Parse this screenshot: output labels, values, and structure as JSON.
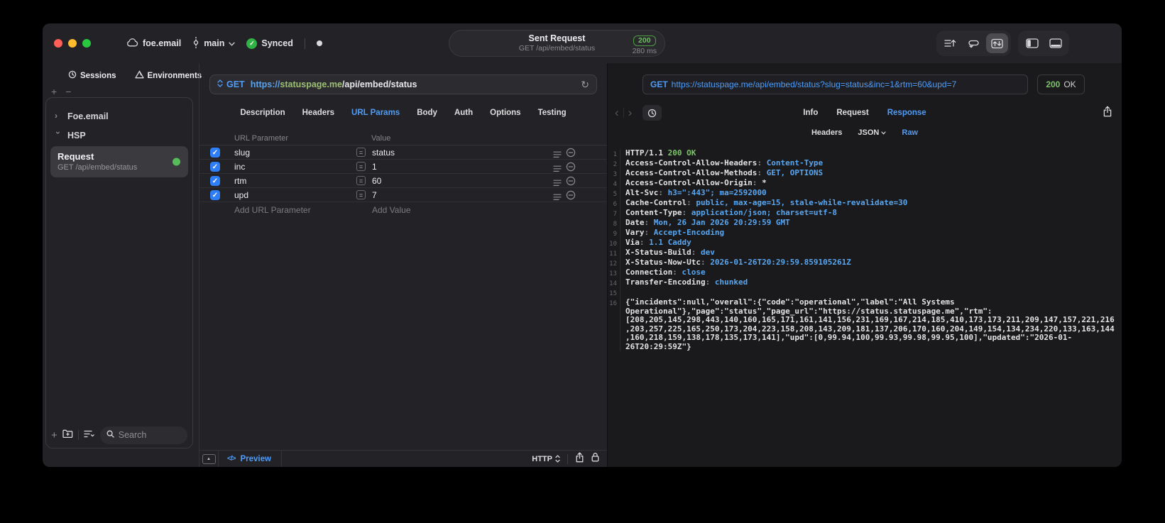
{
  "titlebar": {
    "project": "foe.email",
    "branch": "main",
    "sync_status": "Synced",
    "request_summary": {
      "title": "Sent Request",
      "method_path": "GET /api/embed/status",
      "status_code": "200",
      "duration": "280 ms"
    }
  },
  "sidebar": {
    "tabs": [
      {
        "label": "Sessions",
        "icon": "clock-icon"
      },
      {
        "label": "Environments",
        "icon": "prism-icon"
      }
    ],
    "active_tab": "Sessions",
    "tree": [
      {
        "label": "Foe.email",
        "expanded": false
      },
      {
        "label": "HSP",
        "expanded": true
      }
    ],
    "request_item": {
      "title": "Request",
      "subtitle": "GET /api/embed/status",
      "status_dot_color": "#56bd5b"
    },
    "search_placeholder": "Search"
  },
  "request_editor": {
    "method": "GET",
    "url": {
      "scheme": "https://",
      "host": "statuspage.me",
      "path": "/api/embed/status"
    },
    "tabs": [
      "Description",
      "Headers",
      "URL Params",
      "Body",
      "Auth",
      "Options",
      "Testing"
    ],
    "active_tab": "URL Params",
    "params": {
      "columns": [
        "URL Parameter",
        "Value"
      ],
      "rows": [
        {
          "enabled": true,
          "name": "slug",
          "value": "status"
        },
        {
          "enabled": true,
          "name": "inc",
          "value": "1"
        },
        {
          "enabled": true,
          "name": "rtm",
          "value": "60"
        },
        {
          "enabled": true,
          "name": "upd",
          "value": "7"
        }
      ],
      "add_name_placeholder": "Add URL Parameter",
      "add_value_placeholder": "Add Value"
    },
    "footer": {
      "code_icon": "</>",
      "preview_label": "Preview",
      "protocol": "HTTP"
    }
  },
  "response_viewer": {
    "request_line": {
      "method": "GET",
      "url": "https://statuspage.me/api/embed/status?slug=status&inc=1&rtm=60&upd=7"
    },
    "status": {
      "code": "200",
      "label": "OK"
    },
    "tabs": [
      "Info",
      "Request",
      "Response"
    ],
    "active_tab": "Response",
    "subtabs": [
      "Headers",
      "JSON",
      "Raw"
    ],
    "active_subtab": "Raw",
    "lines": [
      {
        "n": 1,
        "seg": [
          [
            "HTTP/1.1 ",
            "w"
          ],
          [
            "200 OK",
            "g"
          ]
        ]
      },
      {
        "n": 2,
        "seg": [
          [
            "Access-Control-Allow-Headers",
            "w"
          ],
          [
            ": ",
            "d"
          ],
          [
            "Content-Type",
            "b"
          ]
        ]
      },
      {
        "n": 3,
        "seg": [
          [
            "Access-Control-Allow-Methods",
            "w"
          ],
          [
            ": ",
            "d"
          ],
          [
            "GET, OPTIONS",
            "b"
          ]
        ]
      },
      {
        "n": 4,
        "seg": [
          [
            "Access-Control-Allow-Origin",
            "w"
          ],
          [
            ": ",
            "d"
          ],
          [
            "*",
            "w"
          ]
        ]
      },
      {
        "n": 5,
        "seg": [
          [
            "Alt-Svc",
            "w"
          ],
          [
            ": ",
            "d"
          ],
          [
            "h3=\":443\"; ma=2592000",
            "b"
          ]
        ]
      },
      {
        "n": 6,
        "seg": [
          [
            "Cache-Control",
            "w"
          ],
          [
            ": ",
            "d"
          ],
          [
            "public, max-age=15, stale-while-revalidate=30",
            "b"
          ]
        ]
      },
      {
        "n": 7,
        "seg": [
          [
            "Content-Type",
            "w"
          ],
          [
            ": ",
            "d"
          ],
          [
            "application/json; charset=utf-8",
            "b"
          ]
        ]
      },
      {
        "n": 8,
        "seg": [
          [
            "Date",
            "w"
          ],
          [
            ": ",
            "d"
          ],
          [
            "Mon, 26 Jan 2026 20:29:59 GMT",
            "b"
          ]
        ]
      },
      {
        "n": 9,
        "seg": [
          [
            "Vary",
            "w"
          ],
          [
            ": ",
            "d"
          ],
          [
            "Accept-Encoding",
            "b"
          ]
        ]
      },
      {
        "n": 10,
        "seg": [
          [
            "Via",
            "w"
          ],
          [
            ": ",
            "d"
          ],
          [
            "1.1 Caddy",
            "b"
          ]
        ]
      },
      {
        "n": 11,
        "seg": [
          [
            "X-Status-Build",
            "w"
          ],
          [
            ": ",
            "d"
          ],
          [
            "dev",
            "b"
          ]
        ]
      },
      {
        "n": 12,
        "seg": [
          [
            "X-Status-Now-Utc",
            "w"
          ],
          [
            ": ",
            "d"
          ],
          [
            "2026-01-26T20:29:59.859105261Z",
            "b"
          ]
        ]
      },
      {
        "n": 13,
        "seg": [
          [
            "Connection",
            "w"
          ],
          [
            ": ",
            "d"
          ],
          [
            "close",
            "b"
          ]
        ]
      },
      {
        "n": 14,
        "seg": [
          [
            "Transfer-Encoding",
            "w"
          ],
          [
            ": ",
            "d"
          ],
          [
            "chunked",
            "b"
          ]
        ]
      },
      {
        "n": 15,
        "seg": []
      },
      {
        "n": 16,
        "seg": [
          [
            "{\"incidents\":null,\"overall\":{\"code\":\"operational\",\"label\":\"All Systems Operational\"},\"page\":\"status\",\"page_url\":\"https://status.statuspage.me\",\"rtm\":[208,205,145,298,443,140,160,165,171,161,141,156,231,169,167,214,185,410,173,173,211,209,147,157,221,216,203,257,225,165,250,173,204,223,158,208,143,209,181,137,206,170,160,204,149,154,134,234,220,133,163,144,160,218,159,138,178,135,173,141],\"upd\":[0,99.94,100,99.93,99.98,99.95,100],\"updated\":\"2026-01-26T20:29:59Z\"}",
            "w"
          ]
        ]
      }
    ]
  },
  "colors": {
    "accent_blue": "#4f9cf7",
    "header_value_blue": "#58a6f0",
    "success_green": "#7dc36b",
    "badge_green": "#68c15c",
    "checkbox_blue": "#2e7ef7",
    "url_host_green": "#9dbf74",
    "traffic_red": "#ff5f57",
    "traffic_yellow": "#febc2e",
    "traffic_green": "#28c840"
  }
}
